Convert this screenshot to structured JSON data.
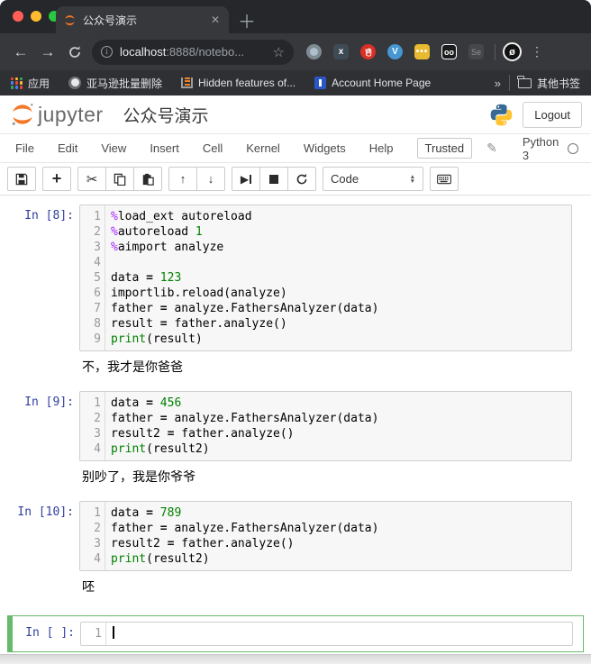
{
  "browser": {
    "tab": {
      "title": "公众号演示",
      "close_glyph": "✕",
      "new_tab_glyph": "＋"
    },
    "nav": {
      "back_glyph": "←",
      "forward_glyph": "→"
    },
    "url": {
      "host": "localhost",
      "rest": ":8888/notebo...",
      "star_glyph": "☆",
      "info_glyph": "i"
    },
    "extensions": {
      "x_label": "x",
      "vimium_label": "V",
      "dots_label": "•••",
      "goggles_label": "oo",
      "selenium_label": "Se",
      "avatar_glyph": "ø",
      "menu_glyph": "⋮"
    },
    "bookmarks": {
      "apps": "应用",
      "amazon": "亚马逊批量删除",
      "hidden": "Hidden features of...",
      "account": "Account Home Page",
      "overflow_glyph": "»",
      "other": "其他书签"
    }
  },
  "jupyter": {
    "logo_text": "jupyter",
    "notebook_title": "公众号演示",
    "logout_label": "Logout",
    "menu": [
      "File",
      "Edit",
      "View",
      "Insert",
      "Cell",
      "Kernel",
      "Widgets",
      "Help"
    ],
    "trusted_label": "Trusted",
    "pencil_glyph": "✎",
    "kernel_name": "Python 3",
    "toolbar": {
      "add_glyph": "+",
      "cut_glyph": "✂",
      "up_glyph": "↑",
      "down_glyph": "↓",
      "run_glyph": "▶",
      "cell_type": "Code"
    },
    "cells": [
      {
        "prompt": "In [8]:",
        "lines": [
          [
            [
              "%",
              "m"
            ],
            [
              "load_ext autoreload",
              ""
            ]
          ],
          [
            [
              "%",
              "m"
            ],
            [
              "autoreload ",
              ""
            ],
            [
              "1",
              "n"
            ]
          ],
          [
            [
              "%",
              "m"
            ],
            [
              "aimport analyze",
              ""
            ]
          ],
          [],
          [
            [
              "data ",
              ""
            ],
            [
              "=",
              "o"
            ],
            [
              " ",
              ""
            ],
            [
              "123",
              "n"
            ]
          ],
          [
            [
              "importlib.reload(analyze)",
              ""
            ]
          ],
          [
            [
              "father ",
              ""
            ],
            [
              "=",
              "o"
            ],
            [
              " analyze.FathersAnalyzer(data)",
              ""
            ]
          ],
          [
            [
              "result ",
              ""
            ],
            [
              "=",
              "o"
            ],
            [
              " father.analyze()",
              ""
            ]
          ],
          [
            [
              "print",
              "b"
            ],
            [
              "(result)",
              ""
            ]
          ]
        ],
        "output": "不，我才是你爸爸"
      },
      {
        "prompt": "In [9]:",
        "lines": [
          [
            [
              "data ",
              ""
            ],
            [
              "=",
              "o"
            ],
            [
              " ",
              ""
            ],
            [
              "456",
              "n"
            ]
          ],
          [
            [
              "father ",
              ""
            ],
            [
              "=",
              "o"
            ],
            [
              " analyze.FathersAnalyzer(data)",
              ""
            ]
          ],
          [
            [
              "result2 ",
              ""
            ],
            [
              "=",
              "o"
            ],
            [
              " father.analyze()",
              ""
            ]
          ],
          [
            [
              "print",
              "b"
            ],
            [
              "(result2)",
              ""
            ]
          ]
        ],
        "output": "别吵了，我是你爷爷"
      },
      {
        "prompt": "In [10]:",
        "lines": [
          [
            [
              "data ",
              ""
            ],
            [
              "=",
              "o"
            ],
            [
              " ",
              ""
            ],
            [
              "789",
              "n"
            ]
          ],
          [
            [
              "father ",
              ""
            ],
            [
              "=",
              "o"
            ],
            [
              " analyze.FathersAnalyzer(data)",
              ""
            ]
          ],
          [
            [
              "result2 ",
              ""
            ],
            [
              "=",
              "o"
            ],
            [
              " father.analyze()",
              ""
            ]
          ],
          [
            [
              "print",
              "b"
            ],
            [
              "(result2)",
              ""
            ]
          ]
        ],
        "output": "呸"
      },
      {
        "prompt": "In [ ]:",
        "lines": [
          []
        ],
        "output": "",
        "selected": true,
        "cursor": true
      }
    ]
  },
  "colors": {
    "jupyter_orange": "#F37726",
    "selected_green": "#66BB6A",
    "prompt_blue": "#303F9F",
    "magic_purple": "#AA22FF",
    "number_green": "#008000"
  }
}
